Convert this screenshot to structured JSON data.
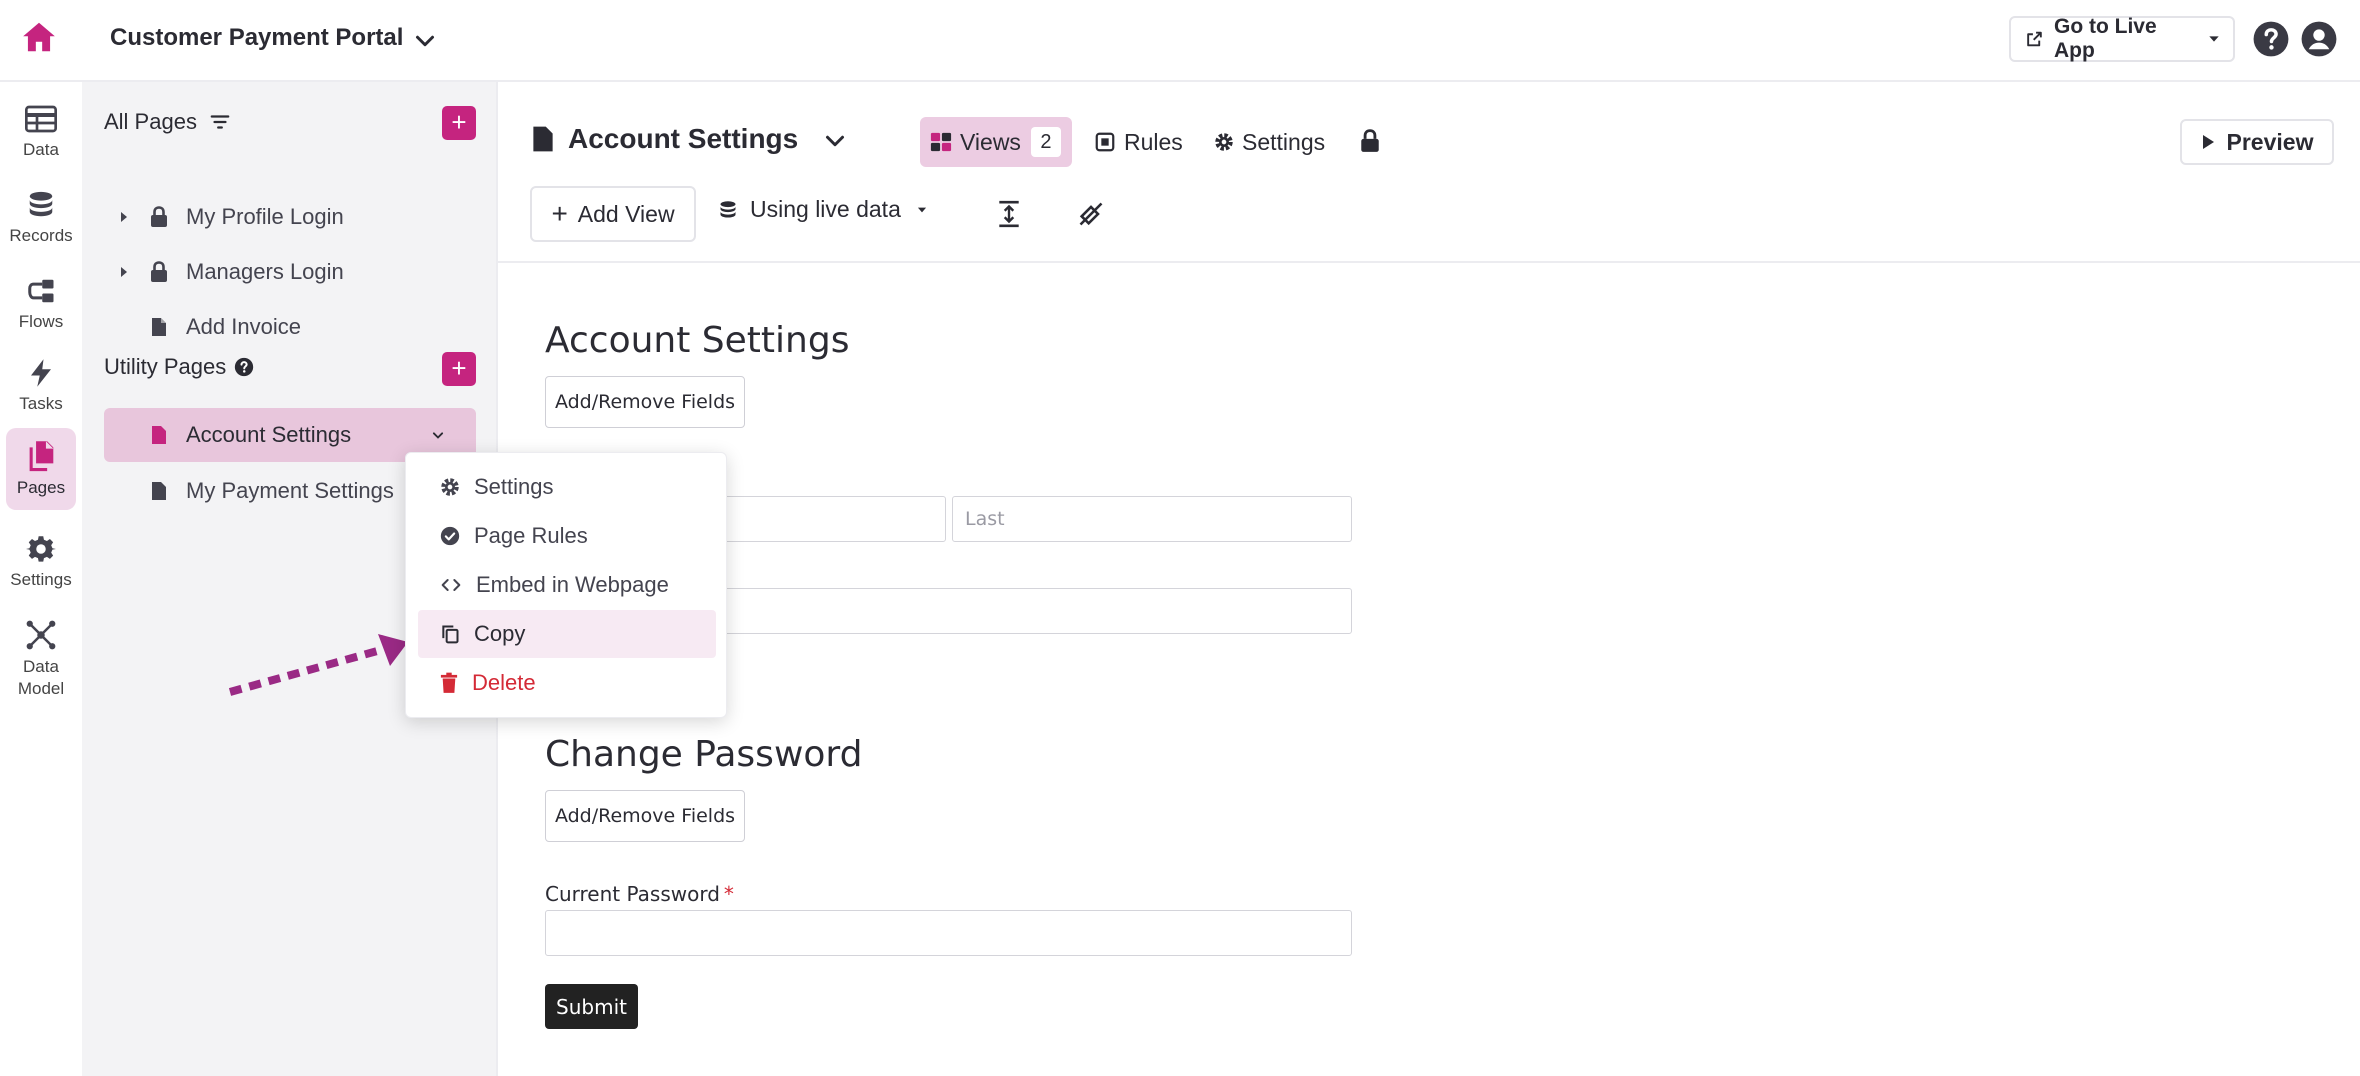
{
  "app": {
    "title": "Customer Payment Portal",
    "live_app_label": "Go to Live App",
    "accent_color": "#c5247f"
  },
  "rail": {
    "items": [
      {
        "label": "Data",
        "icon": "table-icon"
      },
      {
        "label": "Records",
        "icon": "database-icon"
      },
      {
        "label": "Flows",
        "icon": "flows-icon"
      },
      {
        "label": "Tasks",
        "icon": "lightning-icon"
      },
      {
        "label": "Pages",
        "icon": "pages-icon",
        "active": true
      },
      {
        "label": "Settings",
        "icon": "gear-icon"
      },
      {
        "label": "Data Model",
        "icon": "data-model-icon"
      }
    ]
  },
  "tree": {
    "all_pages_label": "All Pages",
    "utility_pages_label": "Utility Pages",
    "add_label": "+",
    "all_pages": [
      {
        "label": "My Profile Login",
        "locked": true,
        "expandable": true
      },
      {
        "label": "Managers Login",
        "locked": true,
        "expandable": true
      },
      {
        "label": "Add Invoice",
        "locked": false,
        "expandable": false
      }
    ],
    "utility_pages": [
      {
        "label": "Account Settings",
        "active": true
      },
      {
        "label": "My Payment Settings",
        "active": false
      }
    ]
  },
  "context_menu": {
    "items": [
      {
        "label": "Settings",
        "icon": "gear-icon"
      },
      {
        "label": "Page Rules",
        "icon": "check-circle-icon"
      },
      {
        "label": "Embed in Webpage",
        "icon": "code-icon"
      },
      {
        "label": "Copy",
        "icon": "copy-icon",
        "highlighted": true
      },
      {
        "label": "Delete",
        "icon": "trash-icon",
        "danger": true
      }
    ]
  },
  "header": {
    "page_title": "Account Settings",
    "tabs": {
      "views_label": "Views",
      "views_count": "2",
      "rules_label": "Rules",
      "settings_label": "Settings"
    },
    "preview_label": "Preview",
    "add_view_label": "Add View",
    "live_data_label": "Using live data"
  },
  "form": {
    "section1_title": "Account Settings",
    "section2_title": "Change Password",
    "add_remove_label": "Add/Remove Fields",
    "last_placeholder": "Last",
    "current_password_label": "Current Password",
    "required_marker": "*",
    "submit_label": "Submit"
  }
}
